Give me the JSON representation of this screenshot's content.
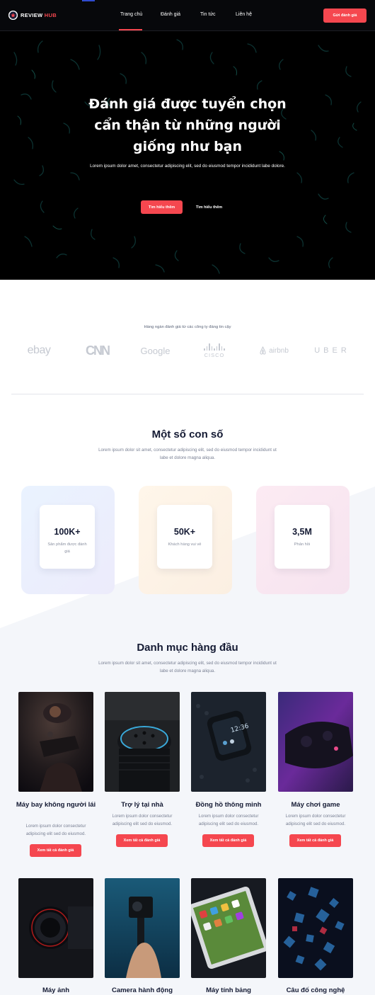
{
  "header": {
    "logo_main": "REVIEW",
    "logo_accent": "HUB",
    "nav": [
      "Trang chủ",
      "Đánh giá",
      "Tin tức",
      "Liên hệ"
    ],
    "cta": "Gửi đánh giá"
  },
  "hero": {
    "title_lines": [
      "Đánh giá được tuyển chọn",
      "cẩn thận từ những người",
      "giống như bạn"
    ],
    "subtitle": "Lorem ipsum dolor amet, consectetur adipiscing elit, sed do eiusmod tempor incididunt labe dolore.",
    "primary_button": "Tìm hiểu thêm",
    "secondary_button": "Tìm hiểu thêm"
  },
  "trusted": {
    "title": "Hàng ngàn đánh giá từ các công ty đáng tin cậy",
    "brands": [
      "ebay",
      "CNN",
      "Google",
      "CISCO",
      "airbnb",
      "UBER"
    ]
  },
  "stats": {
    "title": "Một số con số",
    "subtitle": "Lorem ipsum dolor sit amet, consectetur adipiscing elit, sed do eiusmod tempor incididunt ut labe et dolore magna aliqua.",
    "items": [
      {
        "value": "100K+",
        "label": "Sản phẩm được đánh giá"
      },
      {
        "value": "50K+",
        "label": "Khách hàng vui vẻ"
      },
      {
        "value": "3,5M",
        "label": "Phản hồi"
      }
    ]
  },
  "categories": {
    "title": "Danh mục hàng đầu",
    "subtitle": "Lorem ipsum dolor sit amet, consectetur adipiscing elit, sed do eiusmod tempor incididunt ut labe et dolore magna aliqua.",
    "items": [
      {
        "name": "Máy bay không người lái",
        "desc": "Lorem ipsum dolor consectetur adipiscing elit sed do eiusmod.",
        "button": "Xem tất cả đánh giá"
      },
      {
        "name": "Trợ lý tại nhà",
        "desc": "Lorem ipsum dolor consectetur adipiscing elit sed do eiusmod.",
        "button": "Xem tất cả đánh giá"
      },
      {
        "name": "Đồng hồ thông minh",
        "desc": "Lorem ipsum dolor consectetur adipiscing elit sed do eiusmod.",
        "button": "Xem tất cả đánh giá"
      },
      {
        "name": "Máy chơi game",
        "desc": "Lorem ipsum dolor consectetur adipiscing elit sed do eiusmod.",
        "button": "Xem tất cả đánh giá"
      },
      {
        "name": "Máy ảnh",
        "desc": "",
        "button": ""
      },
      {
        "name": "Camera hành động",
        "desc": "",
        "button": ""
      },
      {
        "name": "Máy tính bảng",
        "desc": "",
        "button": ""
      },
      {
        "name": "Câu đố công nghệ",
        "desc": "",
        "button": ""
      }
    ]
  },
  "colors": {
    "accent": "#f5474f",
    "dark": "#07080b",
    "text": "#141a33"
  }
}
